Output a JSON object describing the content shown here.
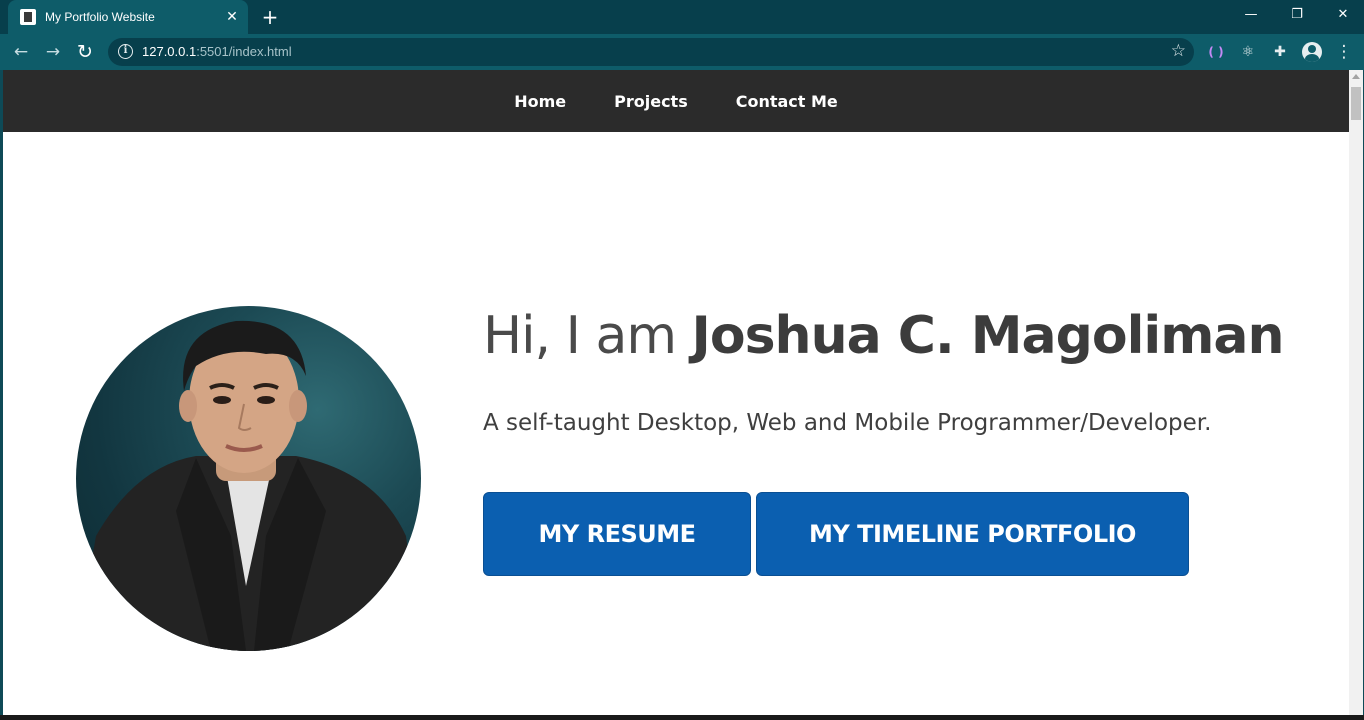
{
  "browser": {
    "tab_title": "My Portfolio Website",
    "tab_close": "✕",
    "new_tab": "+",
    "url_host": "127.0.0.1",
    "url_rest": ":5501/index.html",
    "back": "←",
    "forward": "→",
    "reload": "↻",
    "star": "☆",
    "window_minimize": "—",
    "window_restore": "❐",
    "window_close": "✕",
    "menu": "⋮"
  },
  "site": {
    "nav": [
      "Home",
      "Projects",
      "Contact Me"
    ],
    "hero": {
      "greeting": "Hi, I am ",
      "name": "Joshua C. Magoliman",
      "tagline": "A self-taught Desktop, Web and Mobile Programmer/Developer.",
      "buttons": [
        "MY RESUME",
        "MY TIMELINE PORTFOLIO"
      ]
    }
  },
  "colors": {
    "browser_frame": "#073f4c",
    "toolbar": "#0e5c69",
    "site_nav": "#2b2b2b",
    "button": "#0b5fb0"
  }
}
